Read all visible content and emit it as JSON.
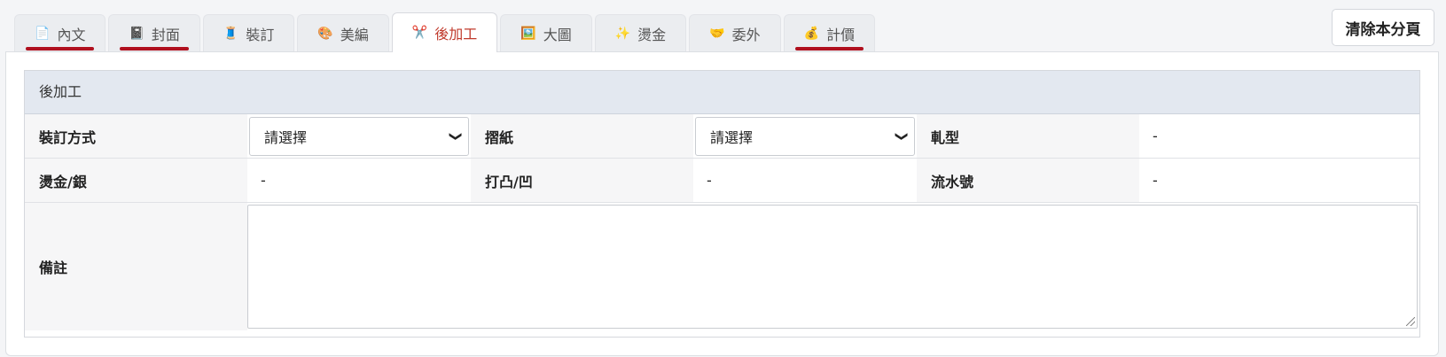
{
  "tabs": [
    {
      "label": "內文",
      "icon": "📄",
      "underline": true
    },
    {
      "label": "封面",
      "icon": "📓",
      "underline": true
    },
    {
      "label": "裝訂",
      "icon": "🧵",
      "underline": false
    },
    {
      "label": "美編",
      "icon": "🎨",
      "underline": false
    },
    {
      "label": "後加工",
      "icon": "✂️",
      "underline": false,
      "active": true
    },
    {
      "label": "大圖",
      "icon": "🖼️",
      "underline": false
    },
    {
      "label": "燙金",
      "icon": "✨",
      "underline": false
    },
    {
      "label": "委外",
      "icon": "🤝",
      "underline": false
    },
    {
      "label": "計價",
      "icon": "💰",
      "underline": true
    }
  ],
  "toolbar": {
    "clear_label": "清除本分頁"
  },
  "section": {
    "title": "後加工",
    "binding_label": "裝訂方式",
    "binding_value": "請選擇",
    "fold_label": "摺紙",
    "fold_value": "請選擇",
    "mold_label": "軋型",
    "mold_value": "-",
    "foil_label": "燙金/銀",
    "foil_value": "-",
    "emboss_label": "打凸/凹",
    "emboss_value": "-",
    "serial_label": "流水號",
    "serial_value": "-",
    "note_label": "備註",
    "note_value": ""
  },
  "colors": {
    "accent": "#b0101e",
    "header_bg": "#e3e8f0"
  }
}
